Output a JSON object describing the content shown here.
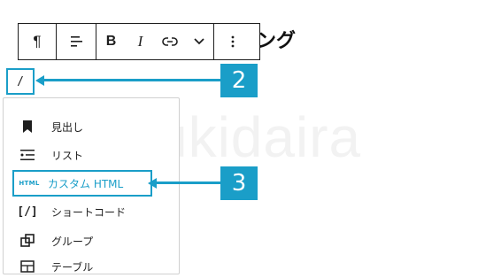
{
  "watermark": "@ukidaira",
  "heading_fragment": "ング",
  "toolbar": {
    "paragraph_icon": "¶",
    "align_icon": "align-left-icon",
    "bold_label": "B",
    "italic_label": "I",
    "link_icon": "link-icon",
    "more_rich_icon": "chevron-down-icon",
    "options_icon": "vertical-ellipsis-icon"
  },
  "slash_input": "/",
  "callouts": {
    "two": "2",
    "three": "3"
  },
  "accent_color": "#1a9ec8",
  "menu": {
    "items": [
      {
        "label": "見出し",
        "icon": "bookmark-icon"
      },
      {
        "label": "リスト",
        "icon": "list-icon"
      },
      {
        "label": "カスタム HTML",
        "icon": "html-icon",
        "icon_text": "HTML",
        "selected": true
      },
      {
        "label": "ショートコード",
        "icon": "shortcode-icon",
        "icon_text": "[/]"
      },
      {
        "label": "グループ",
        "icon": "group-icon"
      },
      {
        "label": "テーブル",
        "icon": "table-icon"
      }
    ]
  }
}
